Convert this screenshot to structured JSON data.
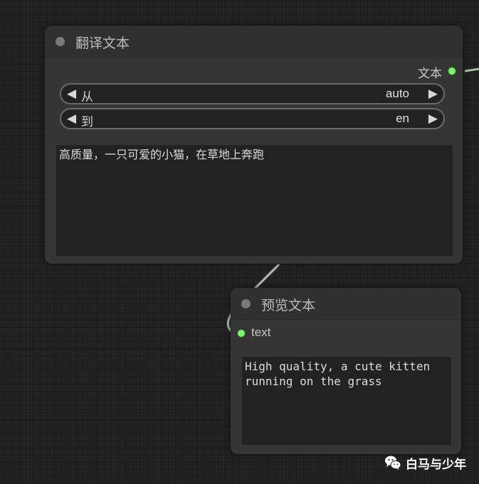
{
  "translate_node": {
    "title": "翻译文本",
    "output_label": "文本",
    "from": {
      "label": "从",
      "value": "auto"
    },
    "to": {
      "label": "到",
      "value": "en"
    },
    "text": "高质量，一只可爱的小猫，在草地上奔跑"
  },
  "preview_node": {
    "title": "预览文本",
    "input_label": "text",
    "text": "High quality, a cute kitten\nrunning on the grass"
  },
  "arrows": {
    "left": "◀",
    "right": "▶"
  },
  "watermark": {
    "text": "白马与少年",
    "icon": "wechat-icon"
  },
  "colors": {
    "canvas": "#222222",
    "node_body": "#353535",
    "node_header": "#303030",
    "slot_connected": "#7df26e",
    "link": "#a9c1a9"
  }
}
